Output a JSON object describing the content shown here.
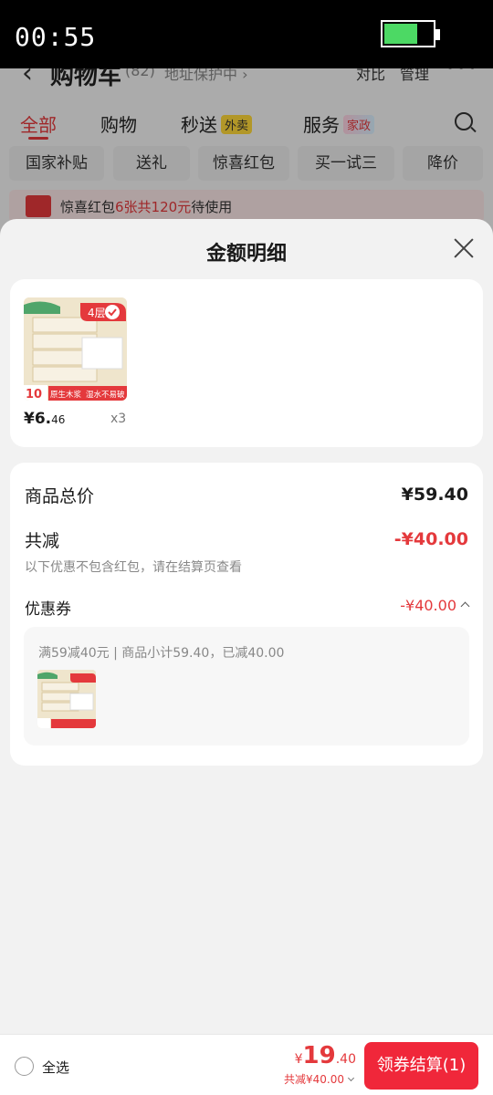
{
  "status_bar": {
    "time": "00:55"
  },
  "cart_page": {
    "title": "购物车",
    "count": "(82)",
    "protect_label": "地址保护中 ›",
    "compare_label": "对比",
    "manage_label": "管理",
    "more_label": "•••",
    "tabs": [
      {
        "label": "全部",
        "badge": ""
      },
      {
        "label": "购物",
        "badge": ""
      },
      {
        "label": "秒送",
        "badge": "外卖"
      },
      {
        "label": "服务",
        "badge": "家政"
      }
    ],
    "chips": [
      "国家补贴",
      "送礼",
      "惊喜红包",
      "买一试三",
      "降价"
    ],
    "promo": {
      "prefix": "惊喜红包",
      "highlight": "6张共120元",
      "suffix": "待使用"
    }
  },
  "sheet": {
    "title": "金额明细",
    "product": {
      "price_int": "¥6.",
      "price_dec": "46",
      "qty": "x3",
      "image_badge": "4层",
      "image_count": "10",
      "image_caption_1": "原生木浆",
      "image_caption_2": "湿水不易破"
    },
    "summary": {
      "total_label": "商品总价",
      "total_value": "¥59.40",
      "discount_label": "共减",
      "discount_value": "-¥40.00",
      "note": "以下优惠不包含红包，请在结算页查看",
      "coupon_label": "优惠券",
      "coupon_value": "-¥40.00",
      "coupon_desc": "满59减40元 | 商品小计59.40，已减40.00"
    }
  },
  "bottom_bar": {
    "select_all": "全选",
    "total_currency": "¥",
    "total_int": "19",
    "total_dec": ".40",
    "saved": "共减¥40.00",
    "checkout": "领券结算(1)"
  },
  "colors": {
    "accent": "#e4393c",
    "checkout_button": "#f0273a"
  }
}
